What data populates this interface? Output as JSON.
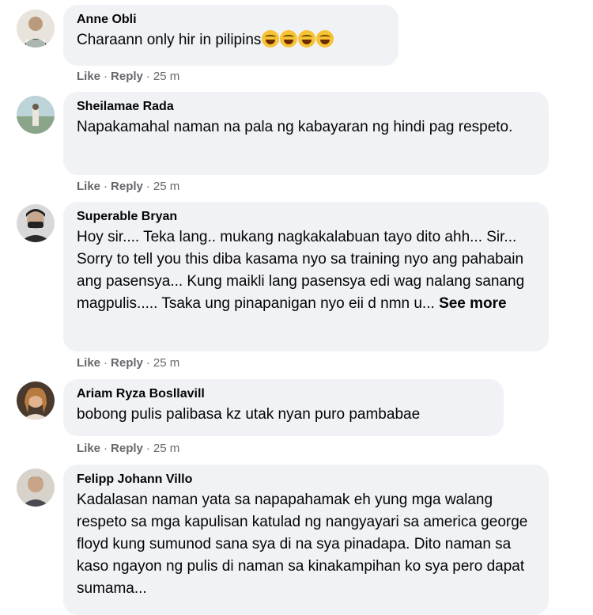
{
  "comments": [
    {
      "author": "Anne Obli",
      "text": "Charaann only hir in pilipins",
      "emoji_count": 4,
      "like": "Like",
      "reply": "Reply",
      "time": "25 m"
    },
    {
      "author": "Sheilamae Rada",
      "text": "Napakamahal naman na pala ng kabayaran ng hindi pag respeto.",
      "like": "Like",
      "reply": "Reply",
      "time": "25 m"
    },
    {
      "author": "Superable Bryan",
      "text": "Hoy sir.... Teka lang.. mukang nagkakalabuan tayo dito ahh... Sir... Sorry to tell you this diba kasama nyo sa training nyo ang pahabain ang pasensya... Kung maikli lang pasensya edi wag nalang sanang magpulis..... Tsaka ung pinapanigan nyo eii d nmn u...",
      "see_more": "See more",
      "like": "Like",
      "reply": "Reply",
      "time": "25 m"
    },
    {
      "author": "Ariam Ryza Bosllavill",
      "text": "bobong pulis palibasa kz utak nyan puro pambabae",
      "like": "Like",
      "reply": "Reply",
      "time": "25 m"
    },
    {
      "author": "Felipp Johann Villo",
      "text": "Kadalasan naman yata sa napapahamak eh yung mga walang respeto sa mga kapulisan katulad ng nangyayari sa america george floyd kung sumunod sana sya di na sya pinadapa. Dito naman sa kaso ngayon ng pulis di naman sa kinakampihan ko sya pero dapat sumama..."
    }
  ],
  "separator": "·",
  "colors": {
    "bubble": "#f0f2f5",
    "meta": "#65676b",
    "text": "#050505"
  }
}
